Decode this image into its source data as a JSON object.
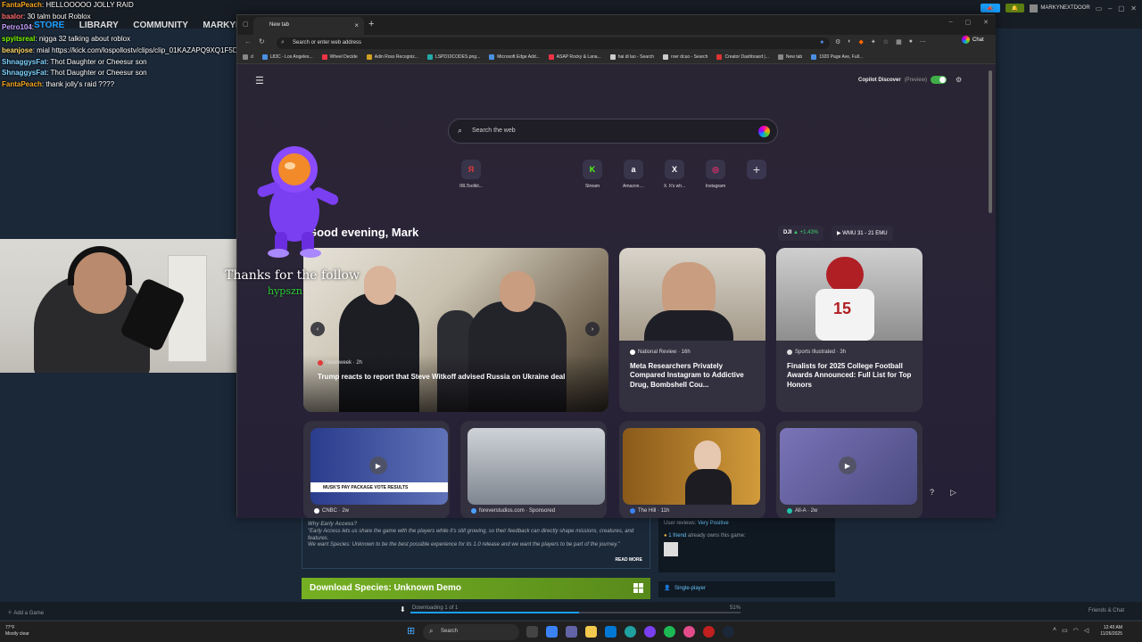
{
  "steam": {
    "nav": [
      "STORE",
      "LIBRARY",
      "COMMUNITY",
      "MARKYNEXTDOOR"
    ],
    "username": "MARKYNEXTDOOR",
    "early_access": {
      "title": "Why Early Access?",
      "body1": "\"Early Access lets us share the game with the players while it's still growing, so their feedback can directly shape missions, creatures, and features.",
      "body2": "We want Species: Unknown to be the best possible experience for its 1.0 release and we want the players to be part of the journey.\"",
      "read_more": "READ MORE"
    },
    "demo_button": "Download Species: Unknown Demo",
    "user_reviews": "User reviews:",
    "user_reviews_value": "Very Positive",
    "friends_owns": "1 friend",
    "friends_owns_rest": "already owns this game:",
    "single_player": "Single-player",
    "add_game": "Add a Game",
    "downloading": "Downloading 1 of 1",
    "download_percent": "51%",
    "download_progress": 0.51,
    "friends_chat": "Friends & Chat"
  },
  "chat_lines": [
    {
      "user": "FantaPeach",
      "color": "#f5a623",
      "msg": "HELLOOOOO JOLLY RAID"
    },
    {
      "user": "baalor",
      "color": "#ff6b6b",
      "msg": "30 talm bout Roblox"
    },
    {
      "user": "Petro104",
      "color": "#c8a2ff",
      "msg": ""
    },
    {
      "user": "spyitsreal",
      "color": "#7cfc00",
      "msg": "nigga 32 talking about roblox"
    },
    {
      "user": "beanjose",
      "color": "#ffd966",
      "msg": "mial https://kick.com/lospollostv/clips/clip_01KAZAPQ9XQ1F5DDNKM8NYSX1E"
    },
    {
      "user": "ShnaggysFat",
      "color": "#7fd3ff",
      "msg": "Thot Daughter or Cheesur son"
    },
    {
      "user": "ShnaggysFat",
      "color": "#7fd3ff",
      "msg": "Thot Daughter or Cheesur son"
    },
    {
      "user": "FantaPeach",
      "color": "#f5a623",
      "msg": "thank jolly's raid ????"
    }
  ],
  "browser": {
    "tab_title": "New tab",
    "address_placeholder": "Search or enter web address",
    "chat_label": "Chat",
    "bookmarks": [
      "d",
      "L83C - Los Angeles...",
      "Wheel Decide",
      "Adin Ross Recogniz...",
      "LSPD10CODES.png...",
      "Microsoft Edge Add...",
      "ASAP Rocky & Lana...",
      "hai di lao - Search",
      "roer dcuo - Search",
      "Creator Dashboard |...",
      "New tab",
      "1920 Page Ave, Full..."
    ],
    "copilot_label": "Copilot Discover",
    "copilot_preview": "(Preview)",
    "search_placeholder": "Search the web",
    "quick_links": [
      {
        "label": "IRLToolkit...",
        "glyph": "Я",
        "color": "#e03a3a"
      },
      {
        "label": "Stream",
        "glyph": "K",
        "color": "#53fc18"
      },
      {
        "label": "Amazon....",
        "glyph": "a",
        "color": "#ffffff"
      },
      {
        "label": "X. It's wh...",
        "glyph": "X",
        "color": "#ffffff"
      },
      {
        "label": "Instagram",
        "glyph": "◎",
        "color": "#e1306c"
      }
    ],
    "greeting": "Good evening, Mark",
    "dji": "DJI",
    "dji_change": "▲ +1.43%",
    "wmu": "▶ WMU 31 - 21 EMU",
    "hero": {
      "source": "Newsweek · 2h",
      "headline": "Trump reacts to report that Steve Witkoff advised Russia on Ukraine deal"
    },
    "cards": [
      {
        "source": "National Review · 16h",
        "headline": "Meta Researchers Privately Compared Instagram to Addictive Drug, Bombshell Cou..."
      },
      {
        "source": "Sports Illustrated · 3h",
        "headline": "Finalists for 2025 College Football Awards Announced: Full List for Top Honors"
      }
    ],
    "videos": [
      {
        "source": "CNBC · 2w",
        "caption": "MUSK'S PAY PACKAGE VOTE RESULTS"
      },
      {
        "source": "foreverstudios.com · Sponsored"
      },
      {
        "source": "The Hill · 11h"
      },
      {
        "source": "All-A · 2w"
      }
    ]
  },
  "overlay": {
    "follow_text": "Thanks for the follow",
    "follower_name": "hypszn"
  },
  "taskbar": {
    "temp": "77°F",
    "weather": "Mostly clear",
    "search": "Search",
    "time": "12:40 AM",
    "date": "11/26/2025"
  }
}
